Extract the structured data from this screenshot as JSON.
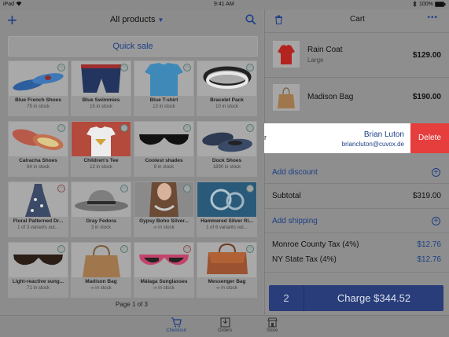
{
  "status_bar": {
    "device": "iPad",
    "wifi": "wifi-icon",
    "time": "9:41 AM",
    "bluetooth": "bluetooth-icon",
    "battery": "100%"
  },
  "products_header": {
    "add_icon": "plus-icon",
    "title": "All products",
    "search_icon": "search-icon"
  },
  "quick_sale": "Quick sale",
  "products": [
    {
      "name": "Blue French Shoes",
      "stock": "75 in stock",
      "badge": "dots-icon"
    },
    {
      "name": "Blue Swimmies",
      "stock": "15 in stock",
      "badge": "dots-icon"
    },
    {
      "name": "Blue T-shirt",
      "stock": "13 in stock",
      "badge": "dots-icon"
    },
    {
      "name": "Bracelet Pack",
      "stock": "10 in stock",
      "badge": "dots-icon"
    },
    {
      "name": "Calracha Shoes",
      "stock": "84 in stock",
      "badge": "dots-icon"
    },
    {
      "name": "Children's Tee",
      "stock": "12 in stock",
      "badge": "dots-icon"
    },
    {
      "name": "Coolest shades",
      "stock": "8 in stock",
      "badge": "dots-icon"
    },
    {
      "name": "Dock Shoes",
      "stock": "1890 in stock",
      "badge": "dots-icon"
    },
    {
      "name": "Floral Patterned Dr...",
      "stock": "1 of 3 variants out...",
      "badge": "dots-icon"
    },
    {
      "name": "Gray Fedora",
      "stock": "3 in stock",
      "badge": "dots-icon"
    },
    {
      "name": "Gypsy Boho Silver...",
      "stock": "∞ in stock",
      "badge": "dots-icon"
    },
    {
      "name": "Hammered Silver Ri...",
      "stock": "1 of 6 variants out...",
      "badge": "dots-icon"
    },
    {
      "name": "Light-reactive sung...",
      "stock": "71 in stock",
      "badge": "dots-icon"
    },
    {
      "name": "Madison Bag",
      "stock": "∞ in stock",
      "badge": "dots-icon"
    },
    {
      "name": "Málaga Sunglasses",
      "stock": "∞ in stock",
      "badge": "dots-icon"
    },
    {
      "name": "Messenger Bag",
      "stock": "∞ in stock",
      "badge": "dots-icon"
    }
  ],
  "pagination": "Page 1 of 3",
  "tabs": [
    {
      "label": "Checkout",
      "icon": "cart-icon",
      "active": true
    },
    {
      "label": "Orders",
      "icon": "inbox-icon",
      "active": false
    },
    {
      "label": "Store",
      "icon": "store-icon",
      "active": false
    }
  ],
  "cart": {
    "title": "Cart",
    "trash_icon": "trash-icon",
    "more_icon": "more-icon",
    "items": [
      {
        "name": "Rain Coat",
        "variant": "Large",
        "price": "$129.00"
      },
      {
        "name": "Madison Bag",
        "variant": "",
        "price": "$190.00"
      }
    ],
    "customer": {
      "truncated_left": "r",
      "name": "Brian Luton",
      "email": "briancluton@cuvox.de",
      "delete_label": "Delete"
    },
    "add_discount": "Add discount",
    "subtotal_label": "Subtotal",
    "subtotal_value": "$319.00",
    "add_shipping": "Add shipping",
    "taxes": [
      {
        "label": "Monroe County Tax (4%)",
        "value": "$12.76"
      },
      {
        "label": "NY State Tax (4%)",
        "value": "$12.76"
      }
    ],
    "charge_count": "2",
    "charge_label": "Charge $344.52"
  },
  "colors": {
    "accent": "#1d3f86",
    "delete": "#e63d3d",
    "charge": "#283d7a"
  }
}
